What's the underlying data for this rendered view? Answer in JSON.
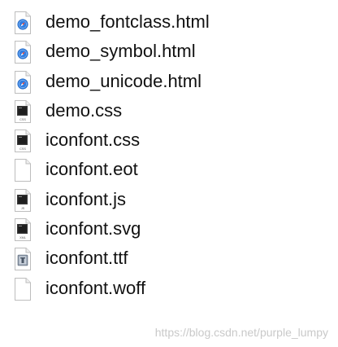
{
  "files": [
    {
      "name": "demo_fontclass.html",
      "icon": "safari-html-file-icon"
    },
    {
      "name": "demo_symbol.html",
      "icon": "safari-html-file-icon"
    },
    {
      "name": "demo_unicode.html",
      "icon": "safari-html-file-icon"
    },
    {
      "name": "demo.css",
      "icon": "css-file-icon",
      "badge": "CSS"
    },
    {
      "name": "iconfont.css",
      "icon": "css-file-icon",
      "badge": "CSS"
    },
    {
      "name": "iconfont.eot",
      "icon": "blank-file-icon"
    },
    {
      "name": "iconfont.js",
      "icon": "js-file-icon",
      "badge": "JS"
    },
    {
      "name": "iconfont.svg",
      "icon": "xml-file-icon",
      "badge": "XML"
    },
    {
      "name": "iconfont.ttf",
      "icon": "font-file-icon"
    },
    {
      "name": "iconfont.woff",
      "icon": "blank-file-icon"
    }
  ],
  "watermark": "https://blog.csdn.net/purple_lumpy",
  "colors": {
    "text": "#111111",
    "safari_blue": "#2f7de1",
    "doc_border": "#bdbdbd",
    "watermark": "#c9c9c9"
  }
}
